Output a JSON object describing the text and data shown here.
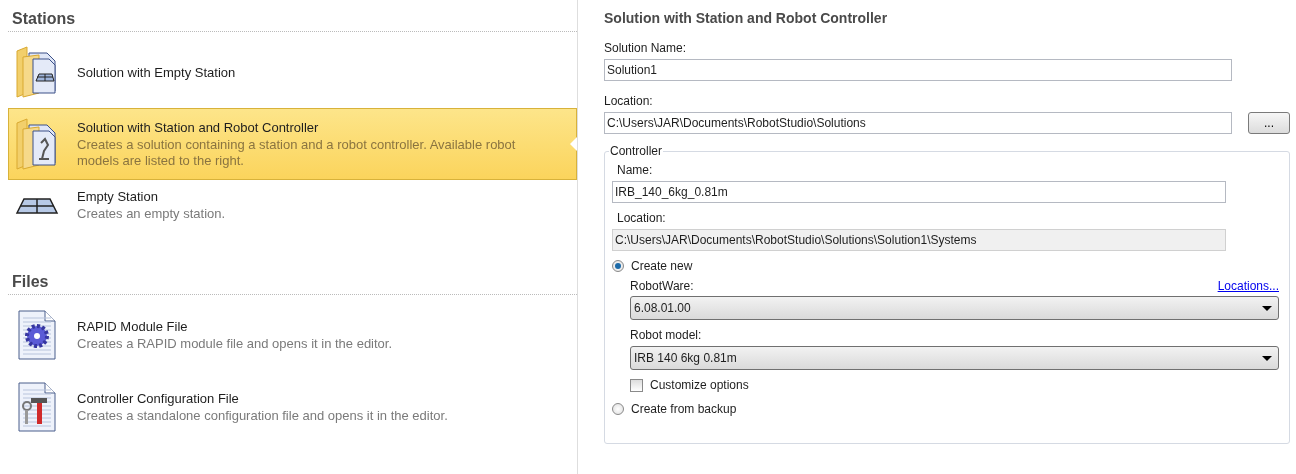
{
  "sections": [
    {
      "title": "Stations",
      "items": [
        {
          "kind": "folder-station",
          "title": "Solution with Empty Station",
          "selected": false
        },
        {
          "kind": "folder-robot",
          "title": "Solution with Station and Robot Controller",
          "description": "Creates a solution containing a station and a robot controller. Available robot models are listed to the right.",
          "selected": true
        },
        {
          "kind": "station",
          "title": "Empty Station",
          "description": "Creates an empty station.",
          "selected": false
        }
      ]
    },
    {
      "title": "Files",
      "items": [
        {
          "kind": "gear-file",
          "title": "RAPID Module File",
          "description": "Creates a RAPID module file and opens it in the editor.",
          "selected": false
        },
        {
          "kind": "tools-file",
          "title": "Controller Configuration File",
          "description": "Creates a standalone configuration file and opens it in the editor.",
          "selected": false
        }
      ]
    }
  ],
  "details": {
    "title": "Solution with Station and Robot Controller",
    "solution_name": {
      "label": "Solution Name:",
      "value": "Solution1"
    },
    "location": {
      "label": "Location:",
      "value": "C:\\Users\\JAR\\Documents\\RobotStudio\\Solutions",
      "browse": "..."
    },
    "controller": {
      "legend": "Controller",
      "name": {
        "label": "Name:",
        "value": "IRB_140_6kg_0.81m"
      },
      "location": {
        "label": "Location:",
        "value": "C:\\Users\\JAR\\Documents\\RobotStudio\\Solutions\\Solution1\\Systems",
        "disabled": true
      },
      "create_new": {
        "label": "Create new",
        "selected": true
      },
      "robotware": {
        "label": "RobotWare:",
        "link": "Locations...",
        "value": "6.08.01.00"
      },
      "robot_model": {
        "label": "Robot model:",
        "value": "IRB 140 6kg 0.81m"
      },
      "customize": {
        "label": "Customize options",
        "checked": false
      },
      "create_from_backup": {
        "label": "Create from backup",
        "selected": false
      }
    }
  }
}
